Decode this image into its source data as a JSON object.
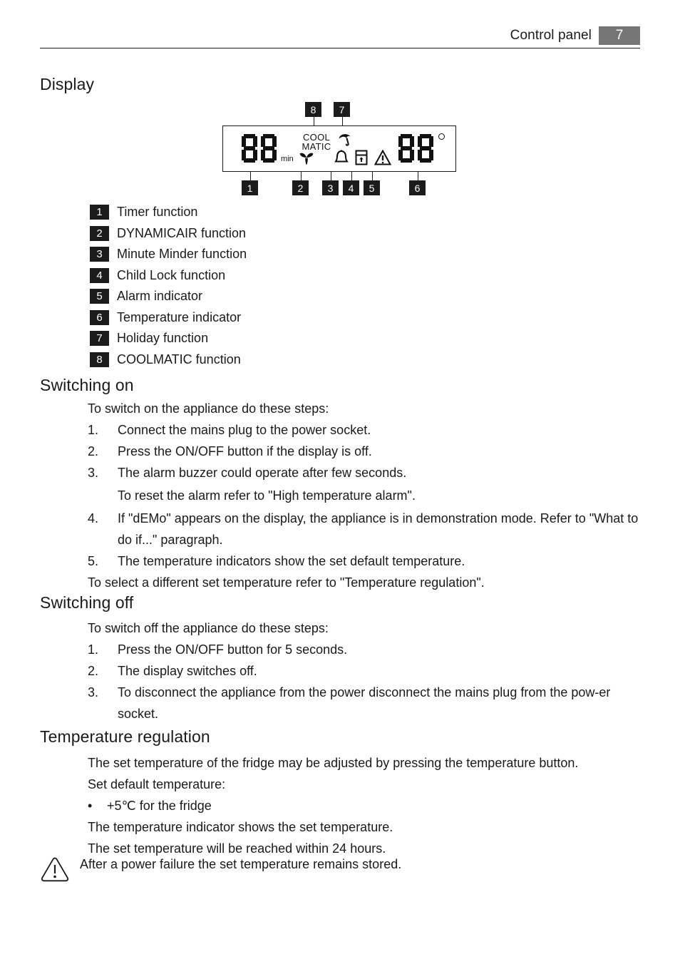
{
  "header": {
    "title": "Control panel",
    "page_number": "7",
    "page_box_color": "#767676"
  },
  "display_section": {
    "heading": "Display",
    "diagram": {
      "callouts_top": [
        {
          "id": "8",
          "icon_name": "coolmatic-label"
        },
        {
          "id": "7",
          "icon_name": "umbrella-icon"
        }
      ],
      "callouts_bottom": [
        {
          "id": "1",
          "icon_name": "timer-digits"
        },
        {
          "id": "2",
          "icon_name": "fan-icon"
        },
        {
          "id": "3",
          "icon_name": "bell-icon"
        },
        {
          "id": "4",
          "icon_name": "child-lock-icon"
        },
        {
          "id": "5",
          "icon_name": "alarm-triangle-icon"
        },
        {
          "id": "6",
          "icon_name": "temperature-digits"
        }
      ],
      "timer_digits": "88",
      "timer_unit": "min",
      "coolmatic_line1": "COOL",
      "coolmatic_line2": "MATIC",
      "temperature_digits": "88",
      "degree_symbol": "°"
    },
    "legend": [
      {
        "num": "1",
        "label": "Timer function"
      },
      {
        "num": "2",
        "label": "DYNAMICAIR function"
      },
      {
        "num": "3",
        "label": "Minute Minder function"
      },
      {
        "num": "4",
        "label": "Child Lock function"
      },
      {
        "num": "5",
        "label": "Alarm indicator"
      },
      {
        "num": "6",
        "label": "Temperature indicator"
      },
      {
        "num": "7",
        "label": "Holiday function"
      },
      {
        "num": "8",
        "label": "COOLMATIC function"
      }
    ]
  },
  "switching_on": {
    "heading": "Switching on",
    "intro": "To switch on the appliance do these steps:",
    "steps": [
      {
        "marker": "1.",
        "text": "Connect the mains plug to the power socket."
      },
      {
        "marker": "2.",
        "text": "Press the ON/OFF button if the display is off."
      },
      {
        "marker": "3.",
        "text": "The alarm buzzer could operate after few seconds."
      }
    ],
    "step3_note": "To reset the alarm refer to \"High temperature alarm\".",
    "step4_marker": "4.",
    "step4_text": "If \"dEMo\" appears on the display, the appliance is in demonstration mode. Refer to \"What to do if...\" paragraph.",
    "step5_marker": "5.",
    "step5_text": "The temperature indicators show the set default temperature.",
    "closing": "To select a different set temperature refer to \"Temperature regulation\"."
  },
  "switching_off": {
    "heading": "Switching off",
    "intro": "To switch off the appliance do these steps:",
    "steps": [
      {
        "marker": "1.",
        "text": "Press the ON/OFF button for 5 seconds."
      },
      {
        "marker": "2.",
        "text": "The display switches off."
      },
      {
        "marker": "3.",
        "text": "To disconnect the appliance from the power disconnect the mains plug from the pow-er socket."
      }
    ]
  },
  "temperature_regulation": {
    "heading": "Temperature regulation",
    "line1": "The set temperature of the fridge may be adjusted by pressing the temperature button.",
    "line2": "Set default temperature:",
    "bullet_dot": "•",
    "bullet_text": "+5℃ for the fridge",
    "line3": "The temperature indicator shows the set temperature.",
    "line4": "The set temperature will be reached within 24 hours."
  },
  "warning_note": {
    "icon_name": "warning-triangle-icon",
    "text": "After a power failure the set temperature remains stored."
  }
}
